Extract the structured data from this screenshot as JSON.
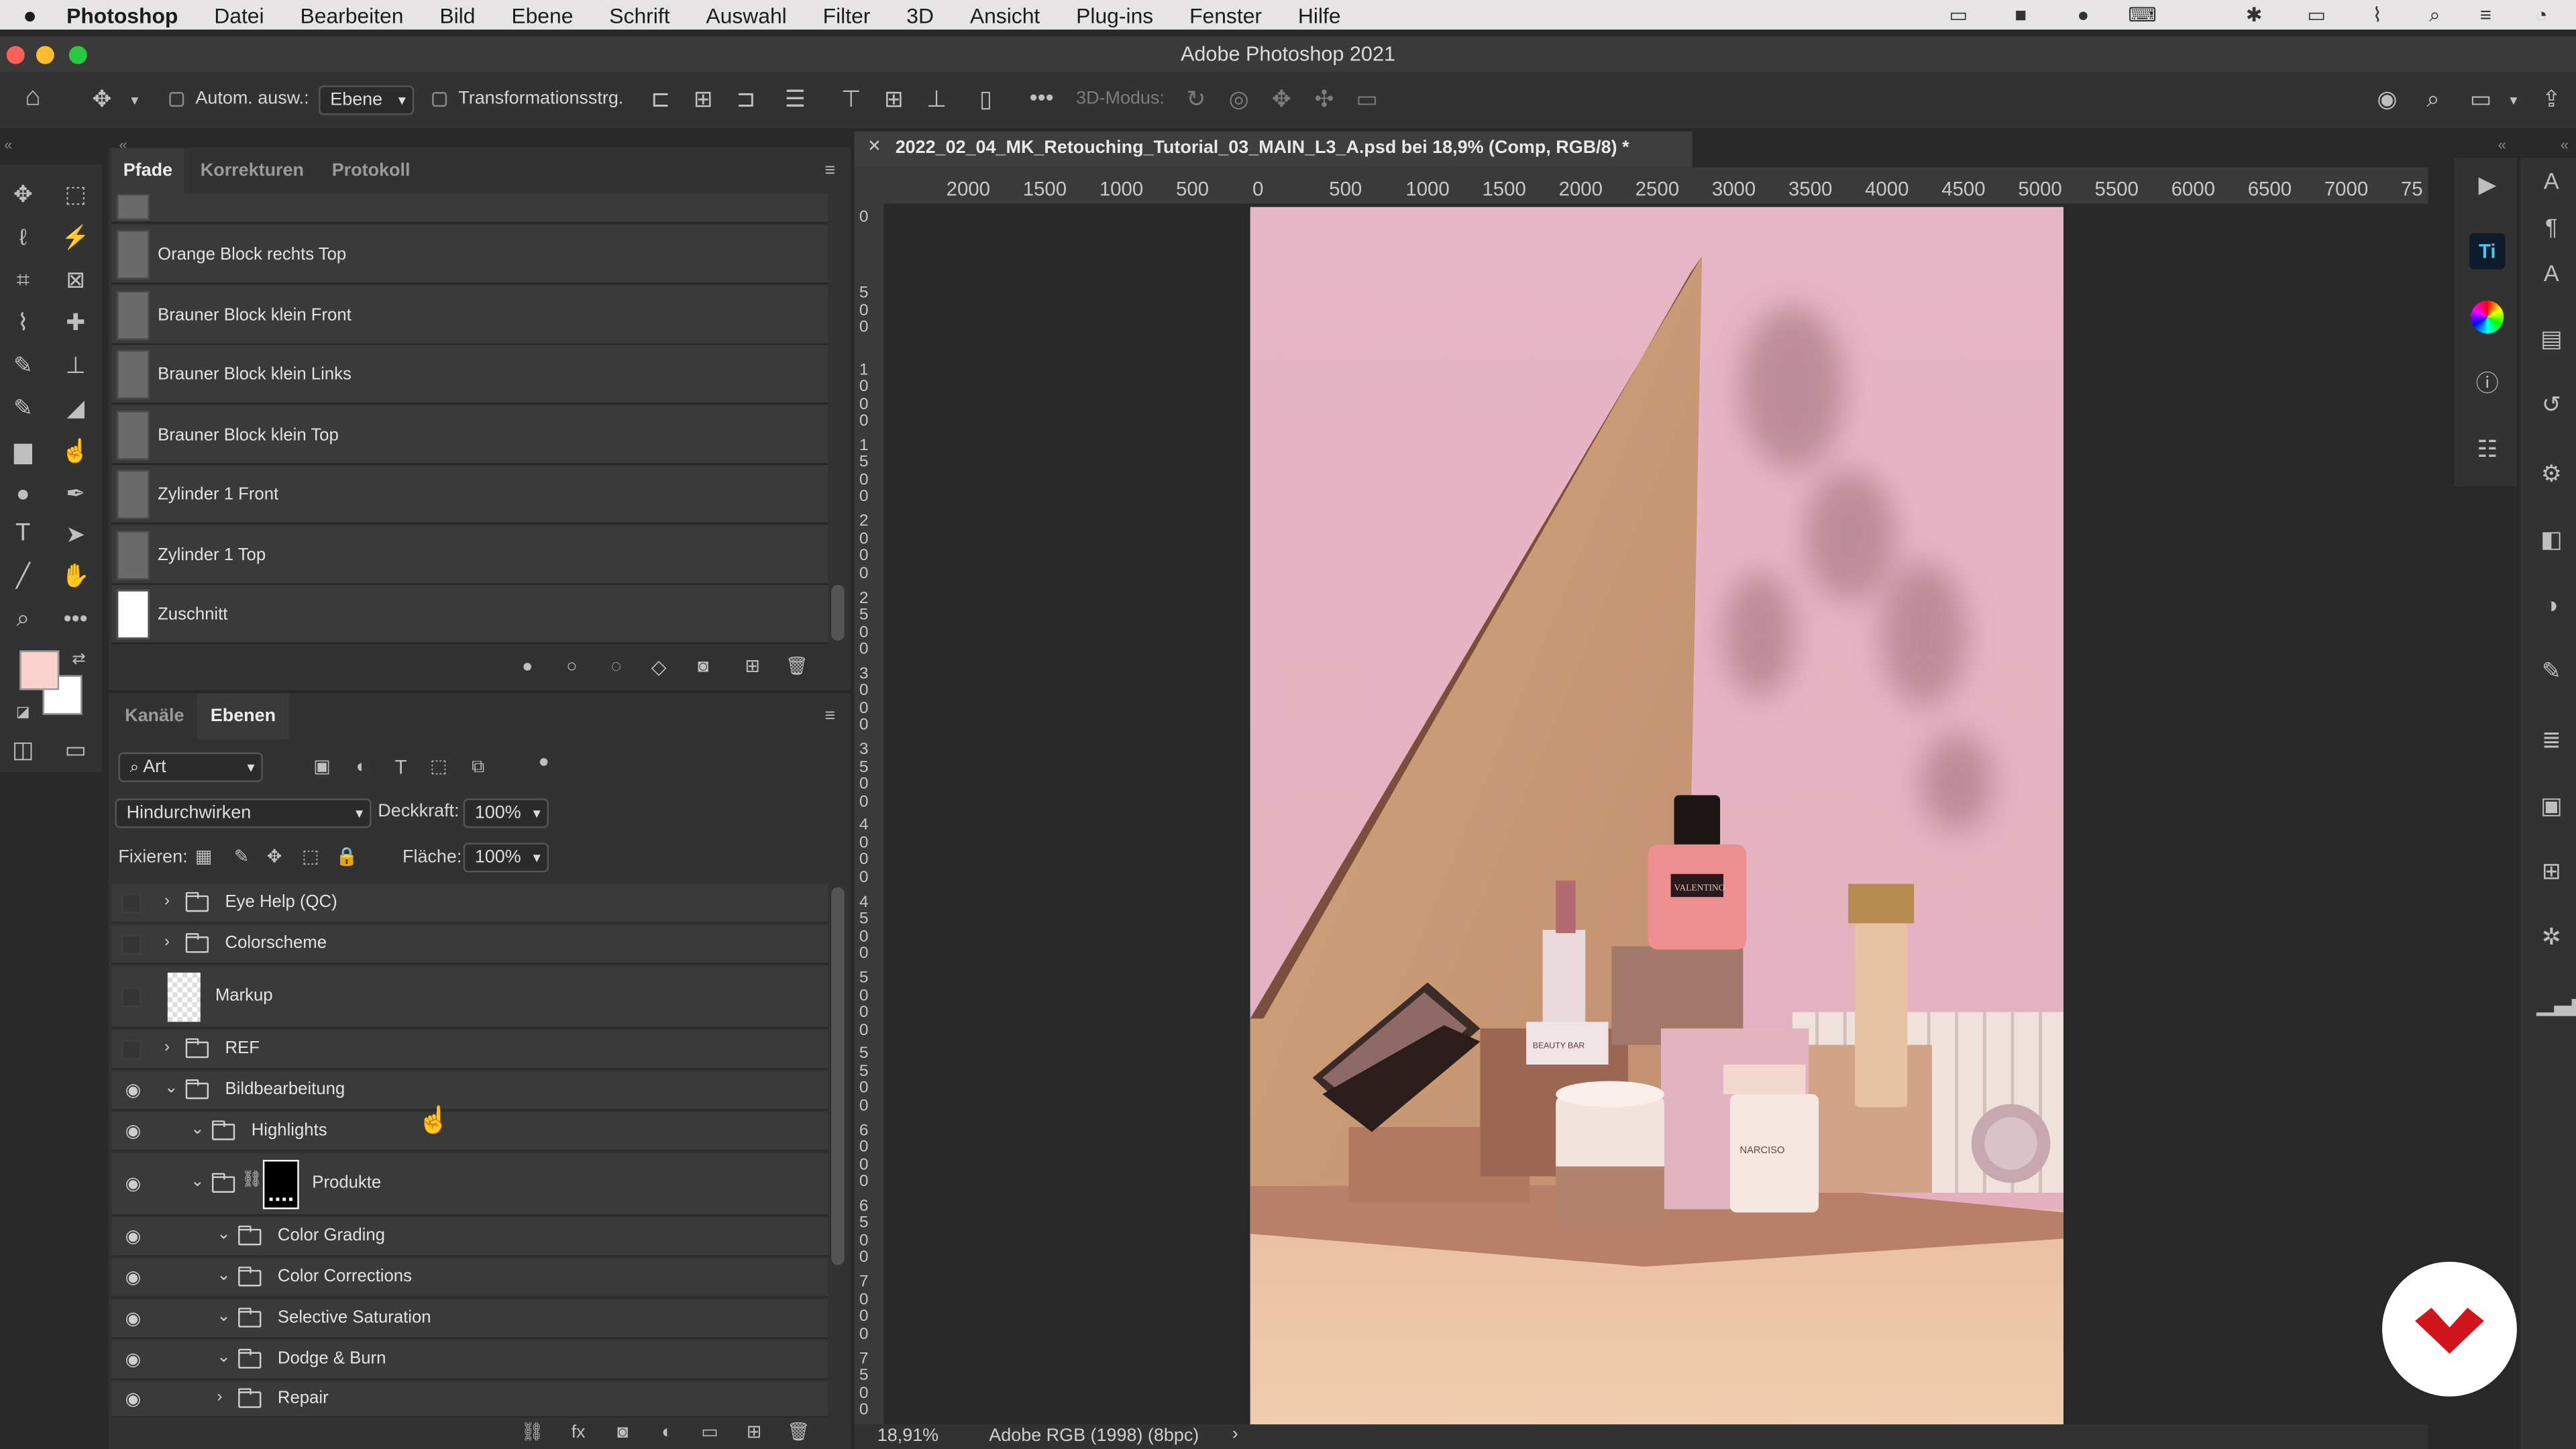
{
  "menubar": {
    "apple_icon": "apple-icon",
    "app": "Photoshop",
    "items": [
      "Datei",
      "Bearbeiten",
      "Bild",
      "Ebene",
      "Schrift",
      "Auswahl",
      "Filter",
      "3D",
      "Ansicht",
      "Plug-ins",
      "Fenster",
      "Hilfe"
    ]
  },
  "window": {
    "title": "Adobe Photoshop 2021"
  },
  "options_bar": {
    "auto_select_label": "Autom. ausw.:",
    "auto_select_value": "Ebene",
    "transform_controls_label": "Transformationsstrg.",
    "mode_3d_label": "3D-Modus:"
  },
  "paths_panel": {
    "tabs": [
      "Pfade",
      "Korrekturen",
      "Protokoll"
    ],
    "active_tab": "Pfade",
    "items": [
      {
        "label": "Orange Block rechts Top"
      },
      {
        "label": "Brauner Block klein Front"
      },
      {
        "label": "Brauner Block klein Links"
      },
      {
        "label": "Brauner Block klein Top"
      },
      {
        "label": "Zylinder 1 Front"
      },
      {
        "label": "Zylinder 1 Top"
      },
      {
        "label": "Zuschnitt"
      }
    ]
  },
  "layers_panel": {
    "tabs": [
      "Kanäle",
      "Ebenen"
    ],
    "active_tab": "Ebenen",
    "filter_value": "Art",
    "blend_mode": "Hindurchwirken",
    "opacity_label": "Deckkraft:",
    "opacity_value": "100%",
    "lock_label": "Fixieren:",
    "fill_label": "Fläche:",
    "fill_value": "100%",
    "layers": [
      {
        "name": "Eye Help (QC)",
        "type": "group",
        "visible": false,
        "expanded": false,
        "depth": 0
      },
      {
        "name": "Colorscheme",
        "type": "group",
        "visible": false,
        "expanded": false,
        "depth": 0
      },
      {
        "name": "Markup",
        "type": "layer",
        "visible": false,
        "depth": 0
      },
      {
        "name": "REF",
        "type": "group",
        "visible": false,
        "expanded": false,
        "depth": 0
      },
      {
        "name": "Bildbearbeitung",
        "type": "group",
        "visible": true,
        "expanded": true,
        "depth": 0
      },
      {
        "name": "Highlights",
        "type": "group",
        "visible": true,
        "expanded": true,
        "depth": 1
      },
      {
        "name": "Produkte",
        "type": "group-mask",
        "visible": true,
        "expanded": true,
        "depth": 1
      },
      {
        "name": "Color Grading",
        "type": "group",
        "visible": true,
        "expanded": true,
        "depth": 2
      },
      {
        "name": "Color Corrections",
        "type": "group",
        "visible": true,
        "expanded": true,
        "depth": 2
      },
      {
        "name": "Selective Saturation",
        "type": "group",
        "visible": true,
        "expanded": true,
        "depth": 2
      },
      {
        "name": "Dodge & Burn",
        "type": "group",
        "visible": true,
        "expanded": true,
        "depth": 2
      },
      {
        "name": "Repair",
        "type": "group",
        "visible": true,
        "expanded": false,
        "depth": 2
      }
    ]
  },
  "document": {
    "tab_title": "2022_02_04_MK_Retouching_Tutorial_03_MAIN_L3_A.psd bei 18,9% (Comp, RGB/8) *",
    "zoom": "18,91%",
    "color_profile": "Adobe RGB (1998) (8bpc)"
  },
  "ruler": {
    "top_ticks": [
      "2000",
      "1500",
      "1000",
      "500",
      "0",
      "500",
      "1000",
      "1500",
      "2000",
      "2500",
      "3000",
      "3500",
      "4000",
      "4500",
      "5000",
      "5500",
      "6000",
      "6500",
      "7000",
      "75"
    ],
    "left_ticks": [
      "0",
      "500",
      "1000",
      "1500",
      "2000",
      "2500",
      "3000",
      "3500",
      "4000",
      "4500",
      "5000",
      "5500",
      "6000",
      "6500",
      "7000",
      "7500"
    ]
  },
  "product_labels": {
    "bottle": "VALENTINO",
    "jar": "NARCISO",
    "lipstick": "BEAUTY BAR"
  },
  "colors": {
    "foreground": "#f9d2cb",
    "background": "#ffffff",
    "canvas_pink": "#e2b7c5",
    "brand_red": "#d1151d"
  }
}
